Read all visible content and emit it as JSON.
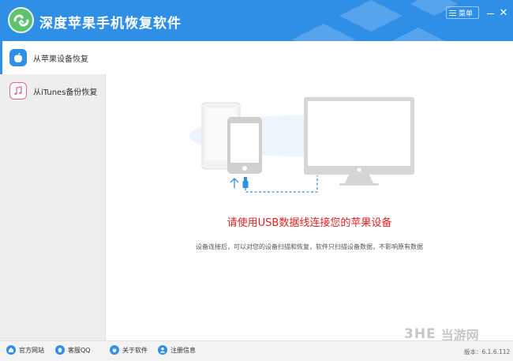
{
  "app": {
    "title": "深度苹果手机恢复软件",
    "menu_label": "菜单",
    "close_glyph": "✕"
  },
  "sidebar": {
    "items": [
      {
        "label": "从苹果设备恢复",
        "icon": "apple-icon",
        "active": true
      },
      {
        "label": "从iTunes备份恢复",
        "icon": "music-note-icon",
        "active": false
      }
    ]
  },
  "main": {
    "prompt": "请使用USB数据线连接您的苹果设备",
    "description": "设备连接后，可以对您的设备扫描和恢复，软件只扫描设备数据，不影响原有数据"
  },
  "watermark": {
    "logo": "3HE",
    "text": "当游网"
  },
  "footer": {
    "links": [
      {
        "label": "官方网站",
        "icon": "home-icon"
      },
      {
        "label": "客服QQ",
        "icon": "qq-icon"
      },
      {
        "label": "关于软件",
        "icon": "info-icon"
      },
      {
        "label": "注册信息",
        "icon": "user-icon"
      }
    ],
    "version": "版本：6.1.6.112"
  },
  "colors": {
    "accent": "#2f8fe6",
    "prompt": "#e12121",
    "sidebar_bg": "#eeeeee"
  }
}
